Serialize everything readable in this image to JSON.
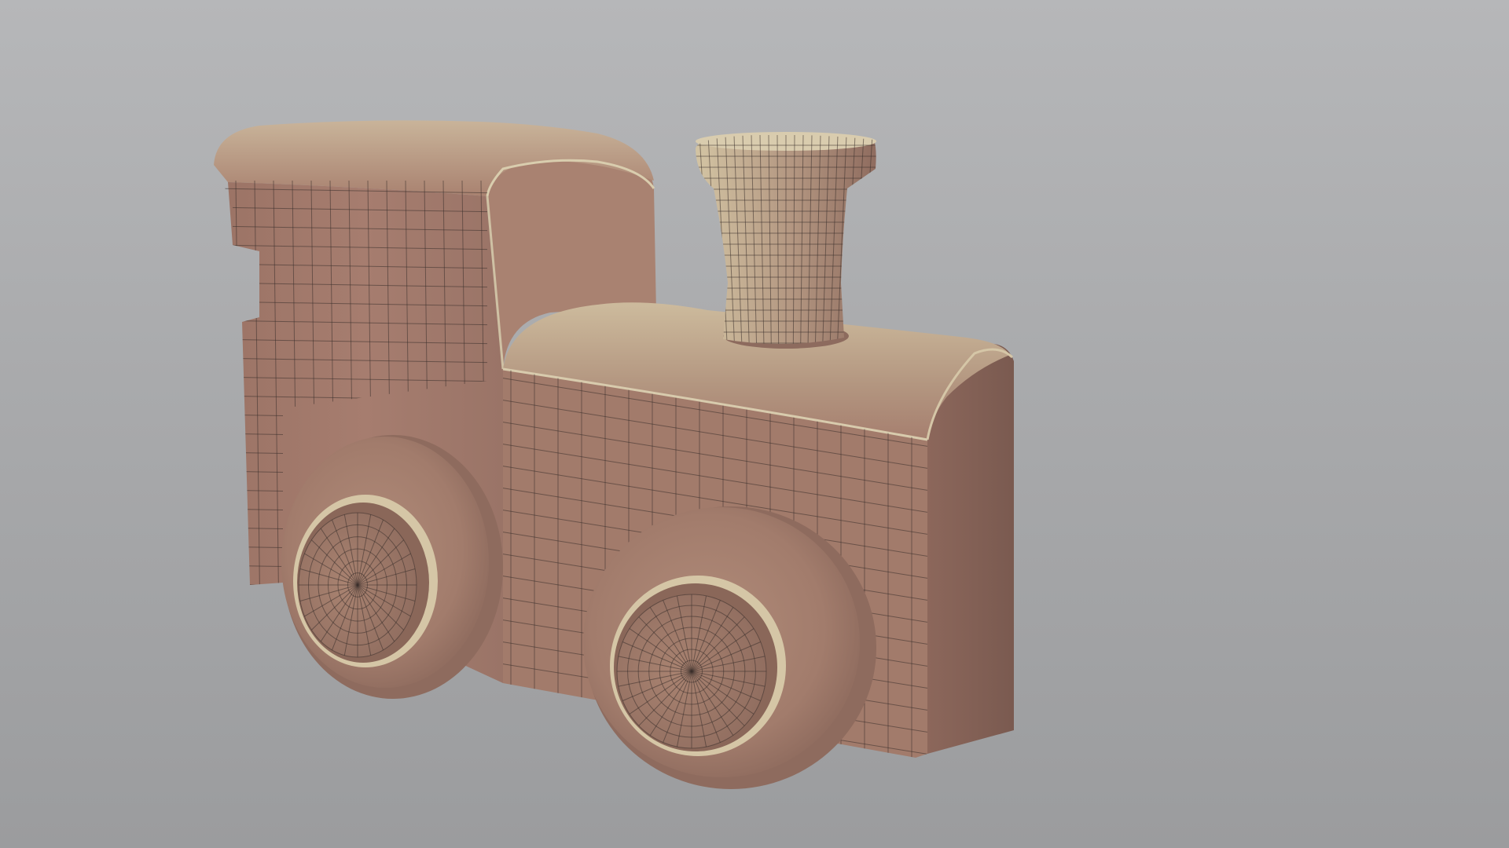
{
  "viewport": {
    "background_top": "#b6b7b9",
    "background_bottom": "#9b9c9e",
    "shading_mode": "wireframe-on-shaded"
  },
  "model": {
    "object": "toy-train-locomotive",
    "base_color": "#a67d6f",
    "highlight_color": "#d6c8a6",
    "wire_color": "#3a2f2b",
    "parts": [
      "cab",
      "boiler",
      "smokestack",
      "rear-wheel",
      "front-wheel"
    ]
  }
}
